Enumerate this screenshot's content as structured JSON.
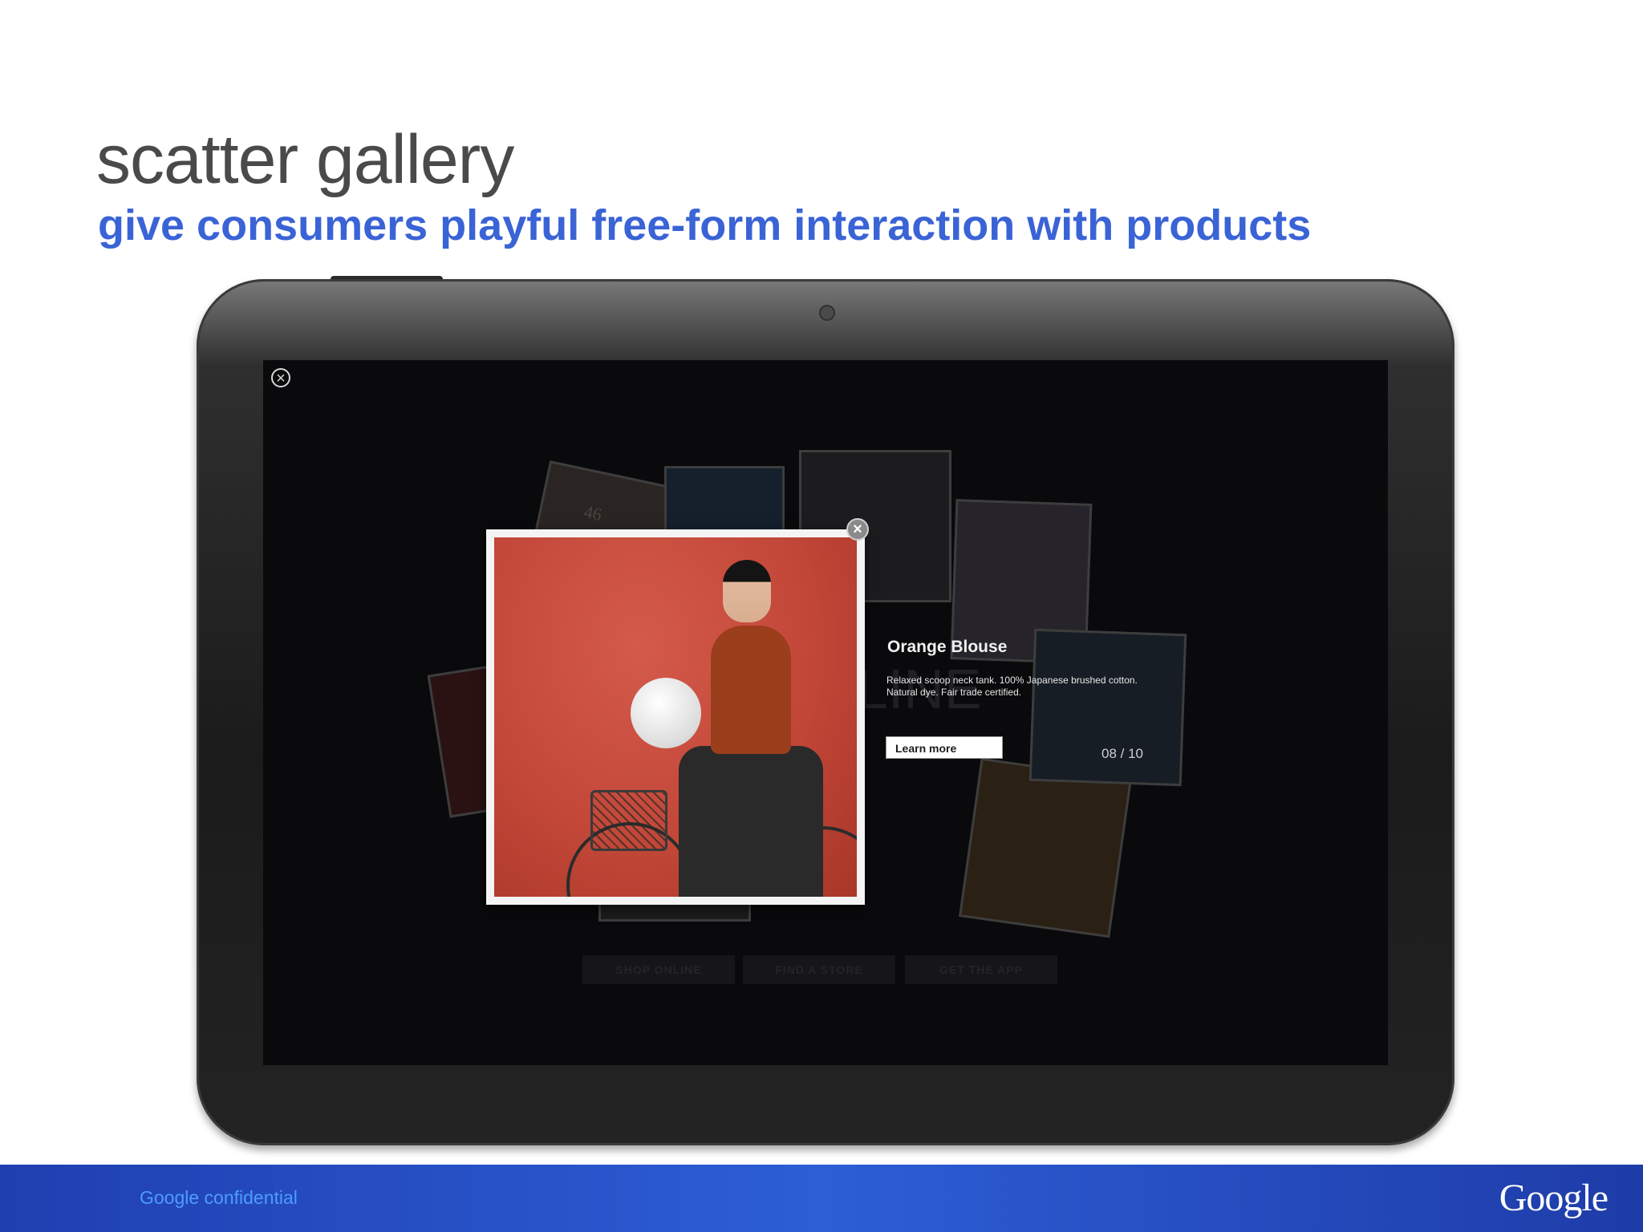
{
  "slide": {
    "title": "scatter gallery",
    "subtitle": "give consumers playful free-form interaction with products"
  },
  "tablet_screen": {
    "product": {
      "name": "Orange Blouse",
      "description": "Relaxed scoop neck tank. 100% Japanese brushed cotton. Natural dye. Fair trade certified.",
      "cta": "Learn more",
      "counter": "08 / 10"
    },
    "background_text": {
      "card_number": "46",
      "online_fragment": "LINE"
    },
    "bottom_buttons": [
      "SHOP ONLINE",
      "FIND A STORE",
      "GET THE APP"
    ],
    "icons": {
      "screen_close": "close-circle-icon",
      "card_close": "close-circle-icon"
    }
  },
  "footer": {
    "left_text": "Google confidential",
    "logo_text": "Google"
  },
  "colors": {
    "title": "#4a4a4a",
    "subtitle": "#3a63d6",
    "footer": "#2d5ed6",
    "screen_bg": "#0a090b"
  }
}
